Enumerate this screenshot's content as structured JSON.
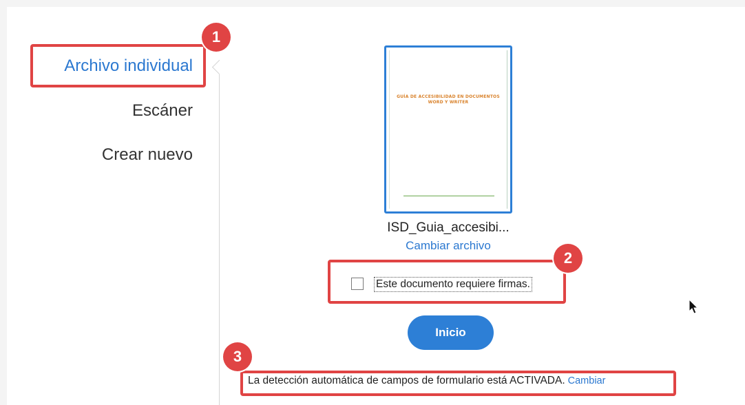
{
  "sidebar": {
    "items": [
      {
        "label": "Archivo individual"
      },
      {
        "label": "Escáner"
      },
      {
        "label": "Crear nuevo"
      }
    ]
  },
  "file": {
    "name": "ISD_Guia_accesibi...",
    "change_label": "Cambiar archivo",
    "preview_title": "GUÍA DE ACCESIBILIDAD EN DOCUMENTOS WORD Y WRITER"
  },
  "signature": {
    "label": "Este documento requiere firmas.",
    "checked": false
  },
  "start_button": "Inicio",
  "detection": {
    "text": "La detección automática de campos de formulario está ACTIVADA.",
    "link": "Cambiar"
  },
  "badges": [
    "1",
    "2",
    "3"
  ],
  "colors": {
    "accent": "#2d7fd6",
    "highlight": "#e04444"
  }
}
